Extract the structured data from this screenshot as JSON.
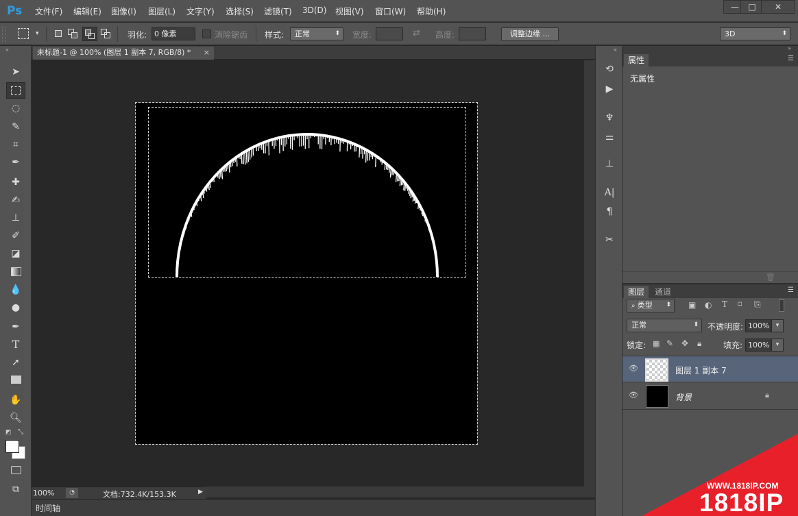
{
  "app": {
    "logo": "Ps"
  },
  "menu": [
    "文件(F)",
    "编辑(E)",
    "图像(I)",
    "图层(L)",
    "文字(Y)",
    "选择(S)",
    "滤镜(T)",
    "3D(D)",
    "视图(V)",
    "窗口(W)",
    "帮助(H)"
  ],
  "window_controls": {
    "minimize": "—",
    "maximize": "□",
    "close": "✕"
  },
  "options": {
    "feather_label": "羽化:",
    "feather_value": "0 像素",
    "antialias_label": "消除锯齿",
    "style_label": "样式:",
    "style_value": "正常",
    "width_label": "宽度:",
    "height_label": "高度:",
    "refine_button": "调整边缘 ...",
    "workspace_value": "3D"
  },
  "document": {
    "tab_title": "未标题-1 @ 100% (图层 1 副本 7, RGB/8) *",
    "tab_close": "×",
    "zoom": "100%",
    "doc_info": "文档:732.4K/153.3K",
    "timeline_label": "时间轴"
  },
  "properties": {
    "tab_label": "属性",
    "content": "无属性"
  },
  "layers": {
    "tabs": [
      "图层",
      "通道"
    ],
    "filter_type": "类型",
    "blend_mode": "正常",
    "opacity_label": "不透明度:",
    "opacity_value": "100%",
    "lock_label": "锁定:",
    "fill_label": "填充:",
    "fill_value": "100%",
    "items": [
      {
        "name": "图层 1 副本 7",
        "selected": true
      },
      {
        "name": "背景",
        "selected": false
      }
    ]
  },
  "watermark": {
    "url": "WWW.1818IP.COM",
    "brand": "1818IP"
  },
  "colors": {
    "accent_logo": "#2f9cdf",
    "selected_layer": "#57647a",
    "watermark_red": "#e8202a"
  }
}
